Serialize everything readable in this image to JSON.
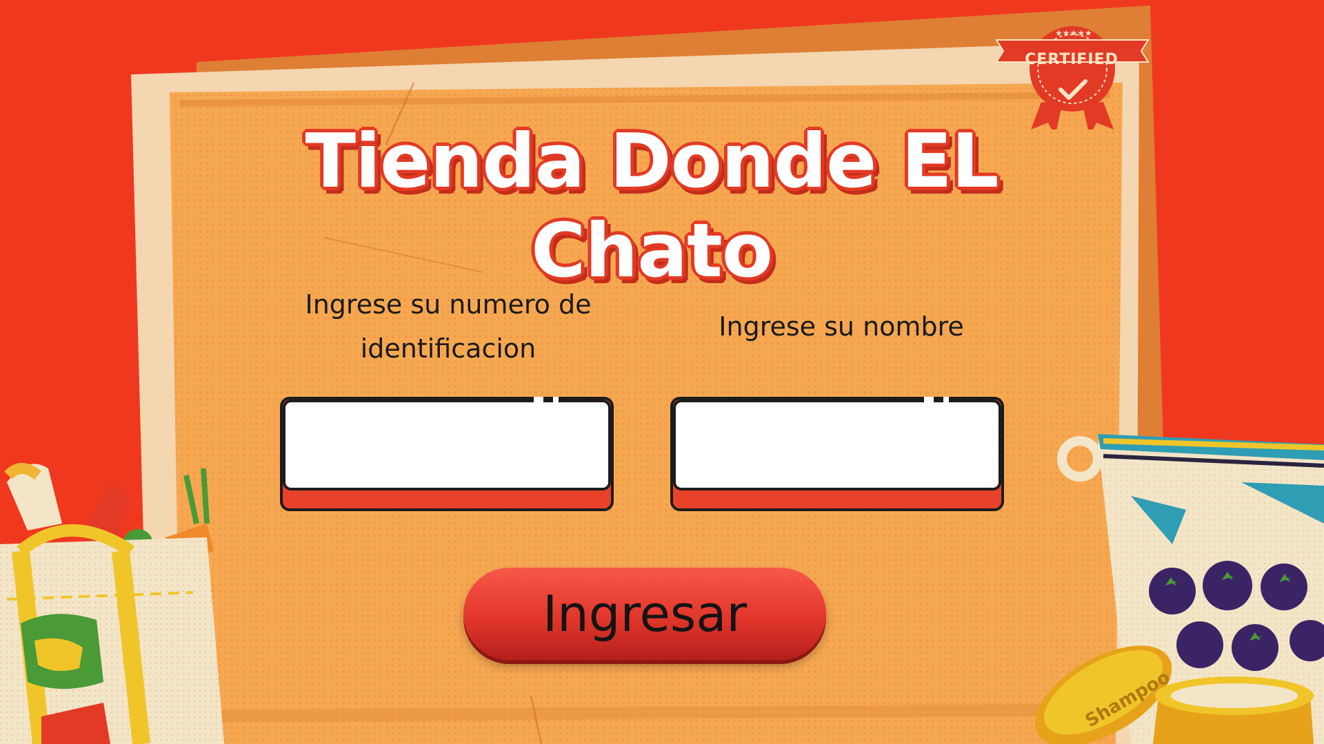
{
  "app": {
    "title": "Tienda Donde EL Chato"
  },
  "badge": {
    "text": "CERTIFIED",
    "icon": "check-icon"
  },
  "form": {
    "id_label": "Ingrese su numero de identificacion",
    "id_value": "",
    "name_label": "Ingrese su nombre",
    "name_value": "",
    "submit_label": "Ingresar"
  },
  "decor": {
    "shampoo_text": "Shampoo"
  },
  "colors": {
    "background": "#f0381f",
    "board": "#f6a851",
    "title_outline": "#e23a25",
    "button": "#e2362b"
  }
}
